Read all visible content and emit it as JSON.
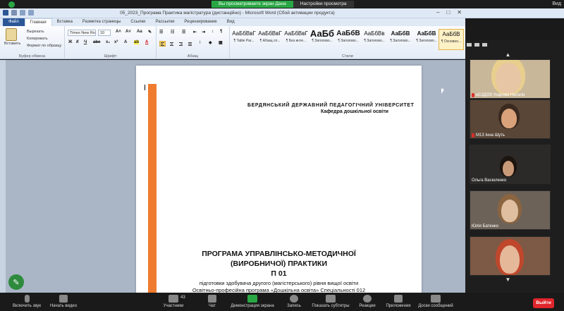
{
  "zoom_banner": {
    "sharing_text": "Вы просматриваете экран Дана",
    "view_options": "Настройки просмотра",
    "exit_label": "Вид"
  },
  "word": {
    "title": "05_2023_Програма Практика магістратура (дистанційно) - Microsoft Word (Сбой активации продукта)",
    "tabs": [
      "Файл",
      "Главная",
      "Вставка",
      "Разметка страницы",
      "Ссылки",
      "Рассылки",
      "Рецензирование",
      "Вид"
    ],
    "active_tab": "Главная",
    "clipboard": {
      "paste": "Вставить",
      "cut": "Вырезать",
      "copy": "Копировать",
      "format_painter": "Формат по образцу",
      "group_label": "Буфер обмена"
    },
    "font": {
      "family": "Times New Ro",
      "size": "10",
      "group_label": "Шрифт"
    },
    "paragraph": {
      "group_label": "Абзац"
    },
    "styles": {
      "group_label": "Стили",
      "items": [
        {
          "sample": "АаБбВвГ",
          "name": "¶ Table Par..."
        },
        {
          "sample": "АаБбВвГ",
          "name": "¶ Абзац сп..."
        },
        {
          "sample": "АаБбВвГ",
          "name": "¶ Без инте..."
        },
        {
          "sample": "АаБб",
          "name": "¶ Заголово..."
        },
        {
          "sample": "АаБбВ",
          "name": "¶ Заголово..."
        },
        {
          "sample": "АаБбВв",
          "name": "¶ Заголово..."
        },
        {
          "sample": "АаБбВ",
          "name": "¶ Заголово..."
        },
        {
          "sample": "АаБбВ",
          "name": "¶ Заголово..."
        },
        {
          "sample": "АаБбВвГ",
          "name": "¶ Обычный"
        },
        {
          "sample": "АаБбВ",
          "name": "¶ Основно..."
        }
      ],
      "change_styles": "Изменить стили"
    },
    "editing": {
      "find": "Найти",
      "replace": "Заменить",
      "select": "Выделить"
    }
  },
  "document": {
    "university": "БЕРДЯНСЬКИЙ ДЕРЖАВНИЙ ПЕДАГОГІЧНИЙ УНІВЕРСИТЕТ",
    "department": "Кафедра дошкільної освіти",
    "title_line1": "ПРОГРАМА УПРАВЛІНСЬКО-МЕТОДИЧНОЇ",
    "title_line2": "(ВИРОБНИЧОЇ) ПРАКТИКИ",
    "code": "П 01",
    "subtitle1": "підготовки здобувача другого (магістерського) рівня вищої освіти",
    "subtitle2": "Освітньо-професійна програма «Дошкільна освіта» Спеціальності 012"
  },
  "participants": [
    {
      "name": "м13ДО9 Укарова Натали",
      "muted": true
    },
    {
      "name": "М13 Інна Шуть",
      "muted": true
    },
    {
      "name": "Ольга Васюленко",
      "muted": false
    },
    {
      "name": "Юлія Батенко",
      "muted": false
    },
    {
      "name": "",
      "muted": false
    }
  ],
  "zoom_toolbar": {
    "mute": "Включить звук",
    "video": "Начать видео",
    "participants": "Участники",
    "participants_count": "43",
    "chat": "Чат",
    "share": "Демонстрация экрана",
    "record": "Запись",
    "captions": "Показать субтитры",
    "reactions": "Реакции",
    "apps": "Приложения",
    "whiteboards": "Доски сообщений",
    "leave": "Выйти"
  },
  "colors": {
    "orange_bar": "#ef7b2e",
    "zoom_green": "#2aa745",
    "leave_red": "#e0262b",
    "word_blue": "#2b5797"
  }
}
